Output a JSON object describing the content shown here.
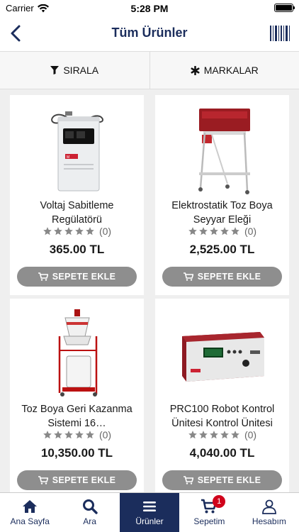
{
  "status": {
    "carrier": "Carrier",
    "time": "5:28 PM",
    "battery_level": 1.0
  },
  "nav": {
    "title": "Tüm Ürünler"
  },
  "filters": {
    "sort_label": "SIRALA",
    "brands_label": "MARKALAR"
  },
  "products": [
    {
      "name": "Voltaj Sabitleme Regülatörü",
      "rating": 0,
      "reviews": "(0)",
      "price": "365.00 TL",
      "cart_label": "SEPETE EKLE"
    },
    {
      "name": "Elektrostatik Toz Boya Seyyar Eleği",
      "rating": 0,
      "reviews": "(0)",
      "price": "2,525.00 TL",
      "cart_label": "SEPETE EKLE"
    },
    {
      "name": "Toz Boya Geri Kazanma Sistemi  16…",
      "rating": 0,
      "reviews": "(0)",
      "price": "10,350.00 TL",
      "cart_label": "SEPETE EKLE"
    },
    {
      "name": "PRC100 Robot Kontrol Ünitesi Kontrol Ünitesi",
      "rating": 0,
      "reviews": "(0)",
      "price": "4,040.00 TL",
      "cart_label": "SEPETE EKLE"
    }
  ],
  "tabs": [
    {
      "label": "Ana Sayfa",
      "icon": "home-icon"
    },
    {
      "label": "Ara",
      "icon": "search-icon"
    },
    {
      "label": "Ürünler",
      "icon": "menu-icon",
      "active": true
    },
    {
      "label": "Sepetim",
      "icon": "cart-icon",
      "badge": "1"
    },
    {
      "label": "Hesabım",
      "icon": "user-icon"
    }
  ],
  "colors": {
    "primary": "#1b2d5c",
    "button_gray": "#8e8e8e",
    "badge_red": "#d0021b"
  }
}
